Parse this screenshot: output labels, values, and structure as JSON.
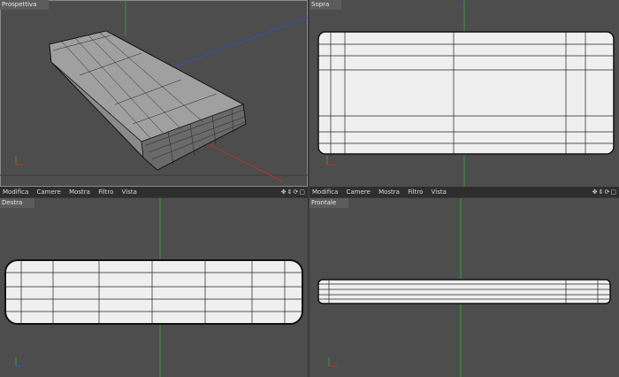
{
  "viewports": {
    "top_left": {
      "label": "Prospettiva"
    },
    "top_right": {
      "label": "Sopra"
    },
    "bottom_left": {
      "label": "Destra"
    },
    "bottom_right": {
      "label": "Frontale"
    }
  },
  "menu": {
    "items": [
      "Modifica",
      "Camere",
      "Mostra",
      "Filtro",
      "Vista"
    ],
    "nav_icons": [
      "move-icon",
      "zoom-icon",
      "rotate-icon",
      "maximize-icon"
    ]
  },
  "axes": {
    "x": "x",
    "y": "y",
    "z": "z"
  },
  "colors": {
    "viewport_bg": "#4d4d4d",
    "x_axis": "#c03030",
    "y_axis": "#30a030",
    "z_axis": "#3050c0",
    "mesh_fill": "#f0f0f0",
    "wire": "#111111"
  }
}
